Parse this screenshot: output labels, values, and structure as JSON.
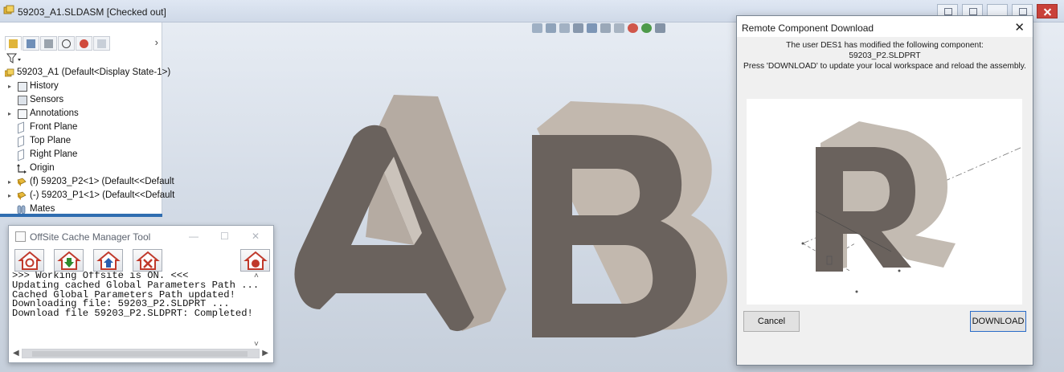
{
  "window": {
    "title": "59203_A1.SLDASM [Checked out]"
  },
  "feature_tree": {
    "root": "59203_A1  (Default<Display State-1>)",
    "items": [
      {
        "label": "History",
        "expandable": true,
        "icon": "history-icon"
      },
      {
        "label": "Sensors",
        "expandable": false,
        "icon": "sensors-icon"
      },
      {
        "label": "Annotations",
        "expandable": true,
        "icon": "annotations-icon"
      },
      {
        "label": "Front Plane",
        "expandable": false,
        "icon": "plane-icon"
      },
      {
        "label": "Top Plane",
        "expandable": false,
        "icon": "plane-icon"
      },
      {
        "label": "Right Plane",
        "expandable": false,
        "icon": "plane-icon"
      },
      {
        "label": "Origin",
        "expandable": false,
        "icon": "origin-icon"
      },
      {
        "label": "(f) 59203_P2<1> (Default<<Default",
        "expandable": true,
        "icon": "part-icon"
      },
      {
        "label": "(-) 59203_P1<1> (Default<<Default",
        "expandable": true,
        "icon": "part-icon"
      },
      {
        "label": "Mates",
        "expandable": false,
        "icon": "mates-icon"
      }
    ]
  },
  "offsite_cache": {
    "title": "OffSite Cache Manager Tool",
    "buttons": [
      {
        "name": "refresh-home-icon",
        "color": "#c0392b"
      },
      {
        "name": "download-home-icon",
        "color": "#2e8b2e"
      },
      {
        "name": "upload-home-icon",
        "color": "#2a5fb0"
      },
      {
        "name": "delete-home-icon",
        "color": "#c0392b"
      },
      {
        "name": "record-home-icon",
        "color": "#c0392b"
      }
    ],
    "log": [
      ">>> Working Offsite is ON. <<<",
      "Updating cached Global Parameters Path ...",
      "Cached Global Parameters Path updated!",
      "Downloading file: 59203_P2.SLDPRT ...",
      "Download file 59203_P2.SLDPRT: Completed!"
    ]
  },
  "remote_dialog": {
    "title": "Remote Component Download",
    "message_line1": "The user DES1 has modified the following component:",
    "message_line2": "59203_P2.SLDPRT",
    "message_line3": "Press 'DOWNLOAD' to update your local workspace and reload the assembly.",
    "cancel_label": "Cancel",
    "download_label": "DOWNLOAD"
  }
}
